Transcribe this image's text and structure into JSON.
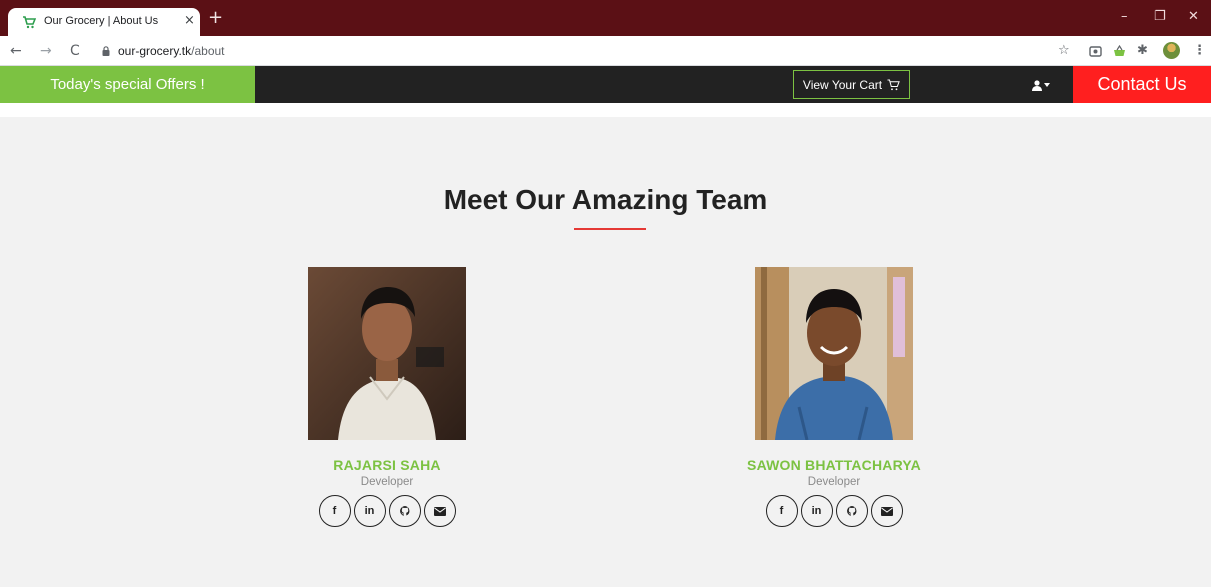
{
  "browser": {
    "tab_title": "Our Grocery | About Us",
    "tab_close": "×",
    "new_tab": "+",
    "url_host": "our-grocery.tk",
    "url_path": "/about",
    "window_controls": {
      "minimize": "–",
      "restore": "❐",
      "close": "✕"
    },
    "nav": {
      "back": "←",
      "forward": "→",
      "reload": "C"
    },
    "toolbar_icons": {
      "star": "☆",
      "extensions": "✱",
      "menu": "⋮"
    }
  },
  "site": {
    "offers_label": "Today's special Offers !",
    "cart_label": "View Your Cart",
    "contact_label": "Contact Us",
    "colors": {
      "green": "#7cc242",
      "red": "#ff1f1f",
      "nav_bg": "#222222",
      "tab_bar": "#5b1015"
    }
  },
  "main": {
    "heading": "Meet Our Amazing Team",
    "team": [
      {
        "name": "RAJARSI SAHA",
        "role": "Developer"
      },
      {
        "name": "SAWON BHATTACHARYA",
        "role": "Developer"
      }
    ],
    "social_icons": [
      "facebook-icon",
      "linkedin-icon",
      "github-icon",
      "email-icon"
    ],
    "social_glyphs": {
      "facebook": "f",
      "linkedin": "in"
    }
  }
}
